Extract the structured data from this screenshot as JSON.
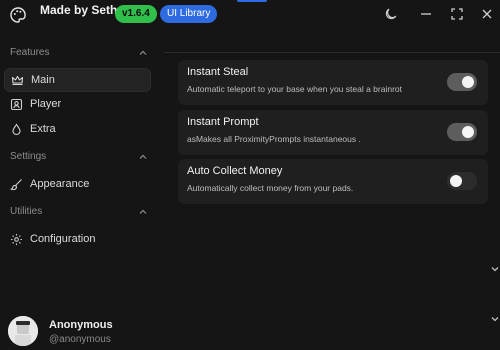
{
  "app": {
    "title": "Made by Seth",
    "version": "v1.6.4",
    "library_badge": "UI Library",
    "colors": {
      "version_badge": "#2fbf4a",
      "library_badge": "#2f6be0",
      "background": "#151515",
      "card": "#1f1f1f"
    }
  },
  "window_controls": [
    "theme-moon-icon",
    "minimize-icon",
    "maximize-icon",
    "close-icon"
  ],
  "sidebar": {
    "sections": [
      {
        "label": "Features",
        "items": [
          {
            "label": "Main",
            "icon": "crown-icon",
            "active": true
          },
          {
            "label": "Player",
            "icon": "user-icon",
            "active": false
          },
          {
            "label": "Extra",
            "icon": "droplet-icon",
            "active": false
          }
        ]
      },
      {
        "label": "Settings",
        "items": [
          {
            "label": "Appearance",
            "icon": "brush-icon",
            "active": false
          }
        ]
      },
      {
        "label": "Utilities",
        "items": [
          {
            "label": "Configuration",
            "icon": "gear-icon",
            "active": false
          }
        ]
      }
    ],
    "profile": {
      "name": "Anonymous",
      "handle": "@anonymous"
    }
  },
  "main": {
    "toggles": [
      {
        "title": "Instant Steal",
        "description": "Automatic teleport to your base when you steal a brainrot",
        "enabled": true
      },
      {
        "title": "Instant Prompt",
        "description": "asMakes all ProximityPrompts instantaneous .",
        "enabled": true
      },
      {
        "title": "Auto Collect Money",
        "description": "Automatically collect money from your pads.",
        "enabled": false
      }
    ]
  }
}
